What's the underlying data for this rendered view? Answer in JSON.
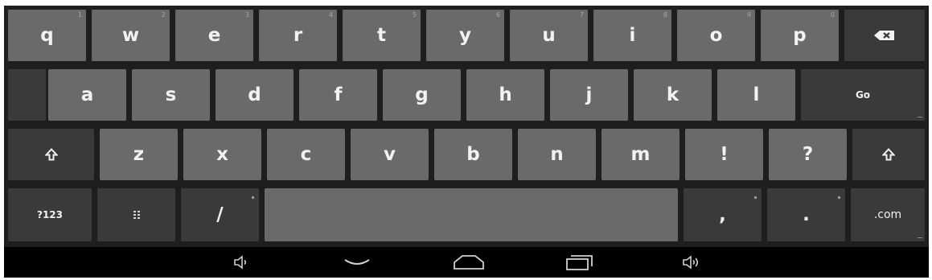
{
  "keyboard": {
    "row1": [
      "q",
      "w",
      "e",
      "r",
      "t",
      "y",
      "u",
      "i",
      "o",
      "p"
    ],
    "row1_hints": [
      "1",
      "2",
      "3",
      "4",
      "5",
      "6",
      "7",
      "8",
      "9",
      "0"
    ],
    "row2": [
      "a",
      "s",
      "d",
      "f",
      "g",
      "h",
      "j",
      "k",
      "l"
    ],
    "row3": [
      "z",
      "x",
      "c",
      "v",
      "b",
      "n",
      "m",
      "!",
      "?"
    ],
    "go_label": "Go",
    "symbols_label": "?123",
    "slash_label": "/",
    "comma_label": ",",
    "period_label": ".",
    "dotcom_label": ".com",
    "icons": {
      "backspace": "backspace-icon",
      "shift_left": "shift-icon",
      "shift_right": "shift-icon",
      "settings": "keyboard-settings-icon"
    },
    "colors": {
      "key_light": "#6a6a6a",
      "key_dark": "#393a3c",
      "background": "#1d1e20"
    }
  },
  "navbar": {
    "icons": [
      "volume-down-icon",
      "back-icon",
      "home-icon",
      "recent-apps-icon",
      "volume-up-icon"
    ]
  }
}
